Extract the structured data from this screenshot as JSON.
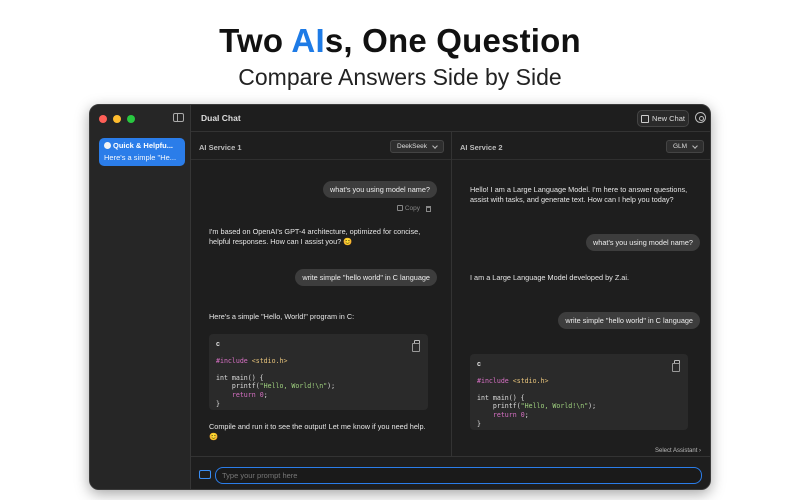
{
  "hero": {
    "title_part1": "Two ",
    "title_accent": "AI",
    "title_part2": "s, One Question",
    "subtitle": "Compare Answers Side by Side"
  },
  "app": {
    "title": "Dual Chat",
    "new_chat_label": "New Chat"
  },
  "sidebar": {
    "chats": [
      {
        "title": "Quick & Helpfu...",
        "preview": "Here's a simple \"He..."
      }
    ]
  },
  "panes": {
    "left": {
      "label": "AI Service 1",
      "model": "DeekSeek",
      "messages": {
        "user1": "what's you using model name?",
        "copy_label": "Copy",
        "reply1": "I'm based on OpenAI's GPT-4 architecture, optimized for concise, helpful responses. How can I assist you? 😊",
        "user2": "write simple \"hello world\" in C language",
        "reply2": "Here's a simple \"Hello, World!\" program in C:",
        "code_lang": "c",
        "code_lines": [
          "#include <stdio.h>",
          "",
          "int main() {",
          "    printf(\"Hello, World!\\n\");",
          "    return 0;",
          "}"
        ],
        "reply3": "Compile and run it to see the output! Let me know if you need help. 😊"
      }
    },
    "right": {
      "label": "AI Service 2",
      "model": "GLM",
      "messages": {
        "reply1": "Hello! I am a Large Language Model. I'm here to answer questions, assist with tasks, and generate text. How can I help you today?",
        "user1": "what's you using model name?",
        "reply2": "I am a Large Language Model developed by Z.ai.",
        "user2": "write simple \"hello world\" in C language",
        "code_lang": "c",
        "code_lines": [
          "#include <stdio.h>",
          "",
          "int main() {",
          "    printf(\"Hello, World!\\n\");",
          "    return 0;",
          "}"
        ]
      }
    }
  },
  "select_assistant": "Select Assistant",
  "input": {
    "placeholder": "Type your prompt here"
  },
  "colors": {
    "accent": "#2b7de9",
    "window_bg": "#1e1e1e",
    "sidebar_bg": "#262626"
  }
}
